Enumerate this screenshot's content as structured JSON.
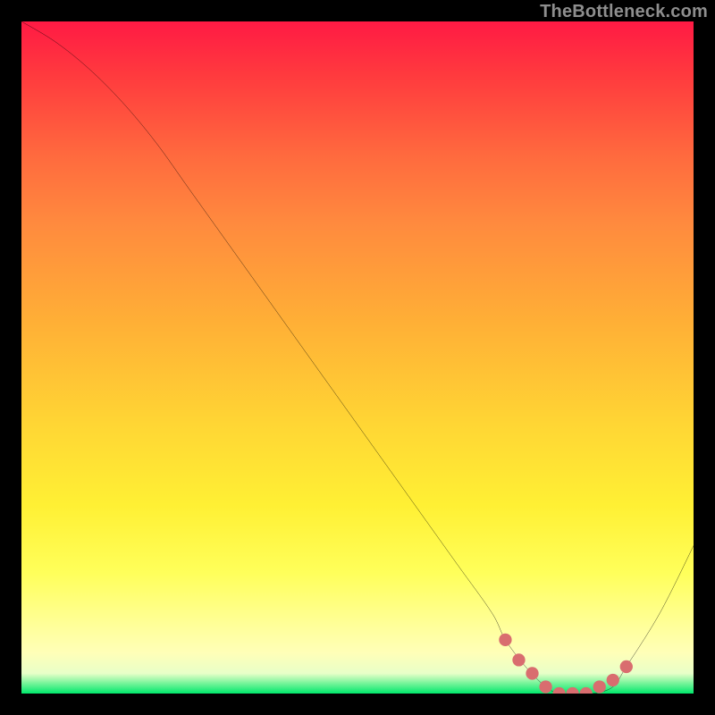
{
  "watermark": "TheBottleneck.com",
  "colors": {
    "curve": "#000000",
    "marker_fill": "#d96d6f",
    "marker_stroke": "#d96d6f",
    "background": "#000000"
  },
  "chart_data": {
    "type": "line",
    "title": "",
    "xlabel": "",
    "ylabel": "",
    "xlim": [
      0,
      100
    ],
    "ylim": [
      0,
      100
    ],
    "series": [
      {
        "name": "bottleneck-curve",
        "x": [
          0,
          5,
          10,
          15,
          20,
          25,
          30,
          35,
          40,
          45,
          50,
          55,
          60,
          65,
          70,
          72,
          75,
          78,
          80,
          82,
          85,
          88,
          90,
          95,
          100
        ],
        "values": [
          100,
          97,
          93,
          88,
          82,
          75,
          68,
          61,
          54,
          47,
          40,
          33,
          26,
          19,
          12,
          8,
          4,
          1,
          0,
          0,
          0,
          1,
          4,
          12,
          22
        ]
      }
    ],
    "markers": {
      "name": "optimal-range",
      "x": [
        72,
        74,
        76,
        78,
        80,
        82,
        84,
        86,
        88,
        90
      ],
      "values": [
        8,
        5,
        3,
        1,
        0,
        0,
        0,
        1,
        2,
        4
      ]
    }
  }
}
